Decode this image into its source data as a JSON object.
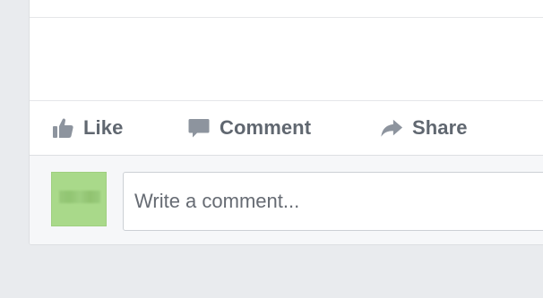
{
  "actions": {
    "like_label": "Like",
    "comment_label": "Comment",
    "share_label": "Share",
    "like_icon": "thumbs-up-icon",
    "comment_icon": "speech-bubble-icon",
    "share_icon": "share-arrow-icon"
  },
  "composer": {
    "placeholder": "Write a comment..."
  },
  "colors": {
    "page_background": "#e9ebee",
    "action_text": "#606770",
    "icon": "#8d949e",
    "avatar": "#a9d98a"
  }
}
